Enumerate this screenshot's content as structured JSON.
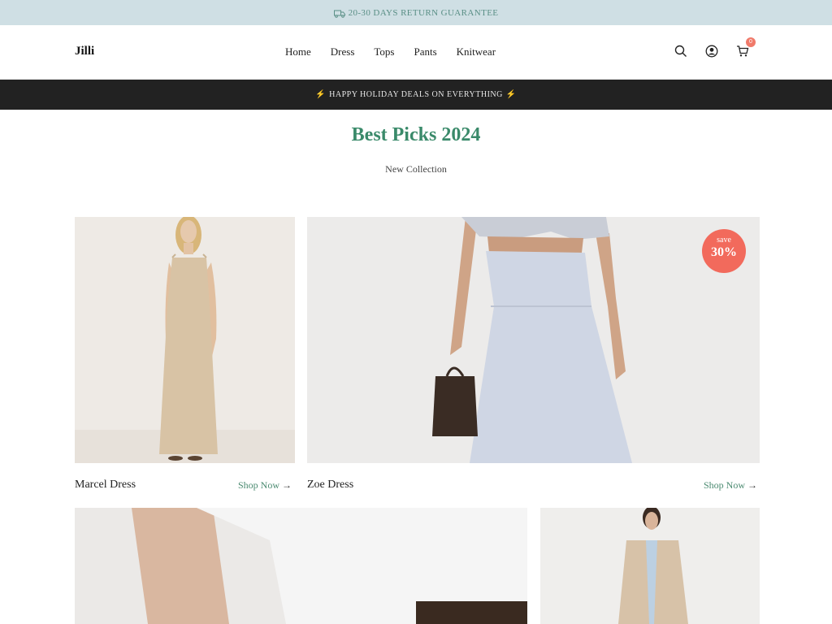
{
  "announcement": {
    "text": "20-30 DAYS RETURN GUARANTEE",
    "icon": "truck-icon"
  },
  "header": {
    "logo": "Jilli",
    "nav": [
      "Home",
      "Dress",
      "Tops",
      "Pants",
      "Knitwear"
    ],
    "icons": [
      "search-icon",
      "account-icon",
      "cart-icon"
    ],
    "cart_count": "0"
  },
  "promo": {
    "text": "HAPPY HOLIDAY DEALS ON EVERYTHING",
    "icon": "lightning-icon"
  },
  "section": {
    "title": "Best Picks 2024",
    "subtitle": "New Collection"
  },
  "products": [
    {
      "name": "Marcel Dress",
      "cta": "Shop Now"
    },
    {
      "name": "Zoe Dress",
      "cta": "Shop Now",
      "badge_top": "save",
      "badge_value": "30%"
    }
  ],
  "colors": {
    "accent_green": "#3a8a6a",
    "badge_coral": "#f26a5c",
    "announce_bg": "#cfdfe4",
    "promo_bg": "#222222"
  }
}
